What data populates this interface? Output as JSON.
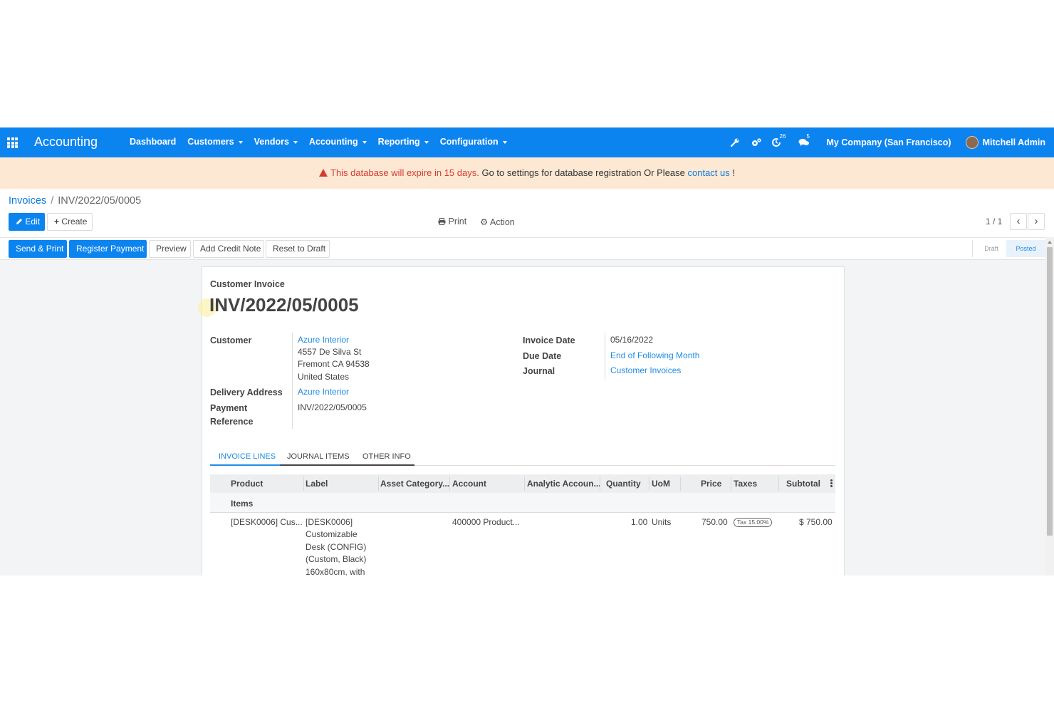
{
  "navbar": {
    "app_name": "Accounting",
    "menu": [
      "Dashboard",
      "Customers",
      "Vendors",
      "Accounting",
      "Reporting",
      "Configuration"
    ],
    "activity_count": "26",
    "message_count": "5",
    "company": "My Company (San Francisco)",
    "user": "Mitchell Admin",
    "color": "#0c84f0"
  },
  "alert": {
    "warning": "This database will expire in 15 days.",
    "message": " Go to settings for database registration Or Please ",
    "link": "contact us",
    "end": " !"
  },
  "breadcrumb": {
    "parent": "Invoices",
    "separator": "/",
    "current": "INV/2022/05/0005"
  },
  "controls": {
    "edit": "Edit",
    "create": "Create",
    "print": "Print",
    "action": "Action",
    "pager": "1 / 1"
  },
  "status_buttons": [
    "Send & Print",
    "Register Payment",
    "Preview",
    "Add Credit Note",
    "Reset to Draft"
  ],
  "statusbar": {
    "draft": "Draft",
    "posted": "Posted",
    "active": "Posted"
  },
  "invoice": {
    "type": "Customer Invoice",
    "name": "INV/2022/05/0005",
    "customer_label": "Customer",
    "customer": "Azure Interior",
    "address": [
      "4557 De Silva St",
      "Fremont CA 94538",
      "United States"
    ],
    "delivery_label": "Delivery Address",
    "delivery": "Azure Interior",
    "payment_ref_label": [
      "Payment",
      "Reference"
    ],
    "payment_ref": "INV/2022/05/0005",
    "invoice_date_label": "Invoice Date",
    "invoice_date": "05/16/2022",
    "due_date_label": "Due Date",
    "due_date": "End of Following Month",
    "journal_label": "Journal",
    "journal": "Customer Invoices"
  },
  "tabs": [
    "INVOICE LINES",
    "JOURNAL ITEMS",
    "OTHER INFO"
  ],
  "table": {
    "columns": [
      "Product",
      "Label",
      "Asset Category...",
      "Account",
      "Analytic Accoun...",
      "Quantity",
      "UoM",
      "Price",
      "Taxes",
      "Subtotal"
    ],
    "section": "Items",
    "rows": [
      {
        "product": "[DESK0006] Cus...",
        "label": [
          "[DESK0006]",
          "Customizable",
          "Desk (CONFIG)",
          "(Custom, Black)",
          "160x80cm, with"
        ],
        "account": "400000 Product...",
        "quantity": "1.00",
        "uom": "Units",
        "price": "750.00",
        "tax": "Tax 15.00%",
        "subtotal": "$ 750.00"
      }
    ]
  }
}
